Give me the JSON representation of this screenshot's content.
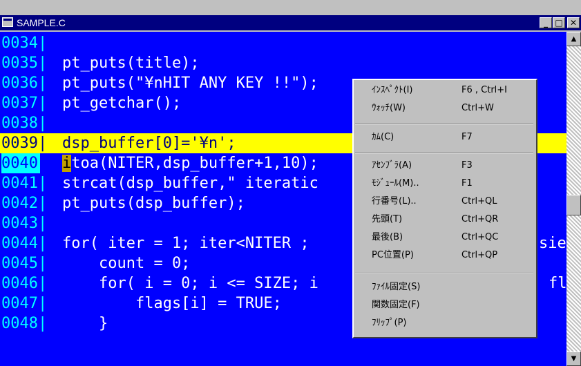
{
  "window": {
    "title": "SAMPLE.C",
    "minimize": "_",
    "restore": "□",
    "close": "✕"
  },
  "colors": {
    "editor_bg": "#0000ff",
    "highlight": "#ffff00",
    "line_number": "#00ffff",
    "titlebar": "#000080"
  },
  "editor": {
    "lines": [
      {
        "num": "0034|",
        "code": ""
      },
      {
        "num": "0035|",
        "code": "pt_puts(title);"
      },
      {
        "num": "0036|",
        "code": "pt_puts(\"¥nHIT ANY KEY !!\");"
      },
      {
        "num": "0037|",
        "code": "pt_getchar();"
      },
      {
        "num": "0038|",
        "code": ""
      },
      {
        "num": "0039|",
        "code": "dsp_buffer[0]='¥n';",
        "highlight": true
      },
      {
        "num": "0040|",
        "caret": "i",
        "code": "toa(NITER,dsp_buffer+1,10);",
        "current": true
      },
      {
        "num": "0041|",
        "code": "strcat(dsp_buffer,\" iteratic"
      },
      {
        "num": "0042|",
        "code": "pt_puts(dsp_buffer);"
      },
      {
        "num": "0043|",
        "code": ""
      },
      {
        "num": "0044|",
        "code": "for( iter = 1; iter<NITER ;",
        "tail": "sie"
      },
      {
        "num": "0045|",
        "code": "    count = 0;"
      },
      {
        "num": "0046|",
        "code": "    for( i = 0; i <= SIZE; i",
        "tail": "fl"
      },
      {
        "num": "0047|",
        "code": "        flags[i] = TRUE;"
      },
      {
        "num": "0048|",
        "code": "    }"
      }
    ]
  },
  "context_menu": {
    "items": [
      {
        "label": "ｲﾝｽﾍﾟｸﾄ(I)",
        "shortcut": "F6 , Ctrl+I"
      },
      {
        "label": "ｳｫｯﾁ(W)",
        "shortcut": "Ctrl+W"
      },
      {
        "label": "ｶﾑ(C)",
        "shortcut": "F7"
      },
      {
        "label": "ｱｾﾝﾌﾞﾗ(A)",
        "shortcut": "F3"
      },
      {
        "label": "ﾓｼﾞｭｰﾙ(M)..",
        "shortcut": "F1"
      },
      {
        "label": "行番号(L)..",
        "shortcut": "Ctrl+QL"
      },
      {
        "label": "先頭(T)",
        "shortcut": "Ctrl+QR"
      },
      {
        "label": "最後(B)",
        "shortcut": "Ctrl+QC"
      },
      {
        "label": "PC位置(P)",
        "shortcut": "Ctrl+QP"
      },
      {
        "label": "ﾌｧｲﾙ固定(S)",
        "shortcut": ""
      },
      {
        "label": "関数固定(F)",
        "shortcut": ""
      },
      {
        "label": "ﾌﾘｯﾌﾟ(P)",
        "shortcut": ""
      }
    ]
  }
}
